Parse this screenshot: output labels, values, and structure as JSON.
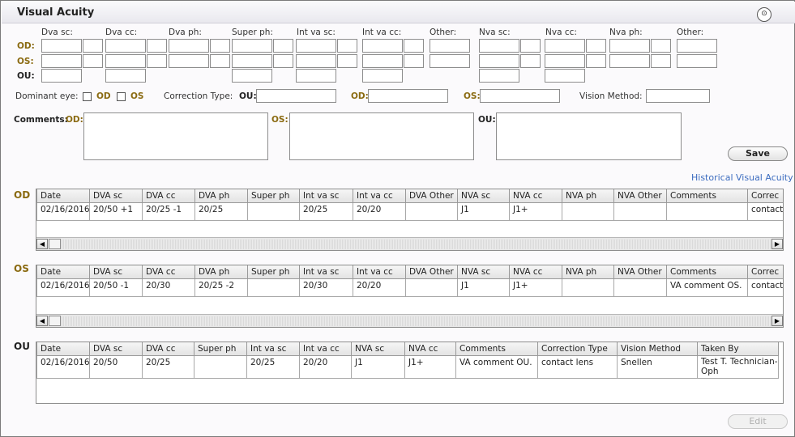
{
  "header": {
    "title": "Visual Acuity",
    "collapse_glyph": "⊙"
  },
  "entry": {
    "col_labels": [
      "Dva sc:",
      "Dva cc:",
      "Dva ph:",
      "Super ph:",
      "Int va sc:",
      "Int va cc:",
      "Other:",
      "Nva sc:",
      "Nva cc:",
      "Nva ph:",
      "Other:"
    ],
    "row_labels": {
      "od": "OD:",
      "os": "OS:",
      "ou": "OU:"
    },
    "dominant_eye_label": "Dominant eye:",
    "dominant_od": "OD",
    "dominant_os": "OS",
    "correction_type_label": "Correction Type:",
    "ct_ou": "OU:",
    "ct_od": "OD:",
    "ct_os": "OS:",
    "vision_method_label": "Vision Method:",
    "comments_label": "Comments:",
    "cm_od": "OD:",
    "cm_os": "OS:",
    "cm_ou": "OU:",
    "save_label": "Save"
  },
  "historical_link": "Historical Visual Acuity",
  "od_table": {
    "label": "OD",
    "headers": [
      "Date",
      "DVA sc",
      "DVA cc",
      "DVA ph",
      "Super ph",
      "Int va sc",
      "Int va cc",
      "DVA Other",
      "NVA sc",
      "NVA cc",
      "NVA ph",
      "NVA Other",
      "Comments",
      "Correc"
    ],
    "rows": [
      [
        "02/16/2016",
        "20/50  +1",
        "20/25  -1",
        "20/25",
        "",
        "20/25",
        "20/20",
        "",
        "J1",
        "J1+",
        "",
        "",
        "",
        "contact"
      ]
    ]
  },
  "os_table": {
    "label": "OS",
    "headers": [
      "Date",
      "DVA sc",
      "DVA cc",
      "DVA ph",
      "Super ph",
      "Int va sc",
      "Int va cc",
      "DVA Other",
      "NVA sc",
      "NVA cc",
      "NVA ph",
      "NVA Other",
      "Comments",
      "Correc"
    ],
    "rows": [
      [
        "02/16/2016",
        "20/50  -1",
        "20/30",
        "20/25  -2",
        "",
        "20/30",
        "20/20",
        "",
        "J1",
        "J1+",
        "",
        "",
        "VA comment OS.",
        "contact"
      ]
    ]
  },
  "ou_table": {
    "label": "OU",
    "headers": [
      "Date",
      "DVA sc",
      "DVA cc",
      "Super ph",
      "Int va sc",
      "Int va cc",
      "NVA sc",
      "NVA cc",
      "Comments",
      "Correction Type",
      "Vision Method",
      "Taken By"
    ],
    "rows": [
      [
        "02/16/2016",
        "20/50",
        "20/25",
        "",
        "20/25",
        "20/20",
        "J1",
        "J1+",
        "VA comment OU.",
        "contact lens",
        "Snellen",
        "Test T. Technician-Oph"
      ]
    ]
  },
  "scroll": {
    "left_arrow": "◀",
    "right_arrow": "▶"
  },
  "edit_label": "Edit",
  "colors": {
    "eye_label_gold": "#8a6a10",
    "link_blue": "#3c6cbf"
  }
}
